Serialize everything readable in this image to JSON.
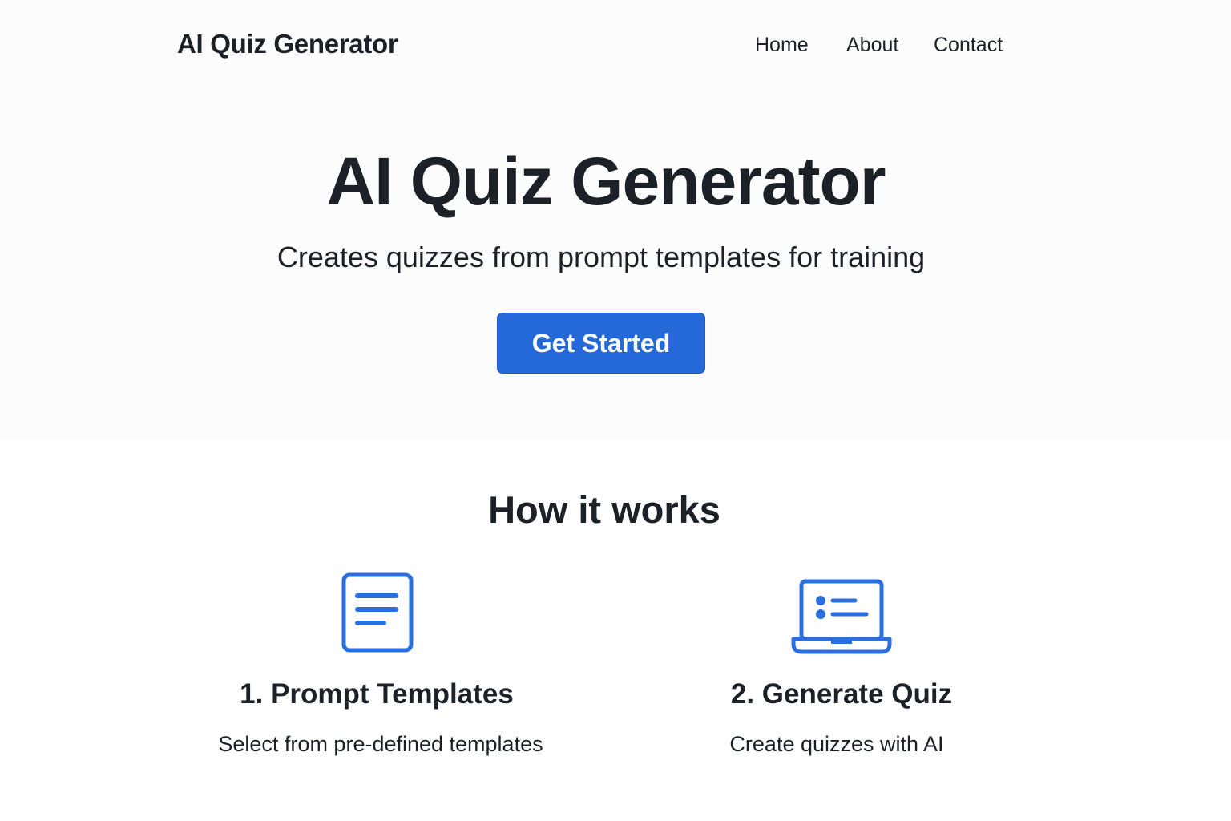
{
  "navbar": {
    "brand": "AI Quiz Generator",
    "links": [
      "Home",
      "About",
      "Contact"
    ]
  },
  "hero": {
    "title": "AI Quiz Generator",
    "subtitle": "Creates quizzes from prompt templates for training",
    "cta_label": "Get Started"
  },
  "how_it_works": {
    "title": "How it works",
    "features": [
      {
        "icon": "document-icon",
        "title": "1. Prompt Templates",
        "description": "Select from pre-defined templates"
      },
      {
        "icon": "laptop-list-icon",
        "title": "2. Generate Quiz",
        "description": "Create quizzes with AI"
      }
    ]
  },
  "colors": {
    "accent": "#2569d8",
    "text": "#1c2128",
    "hero_background": "#fcfcfc",
    "background": "#ffffff"
  }
}
